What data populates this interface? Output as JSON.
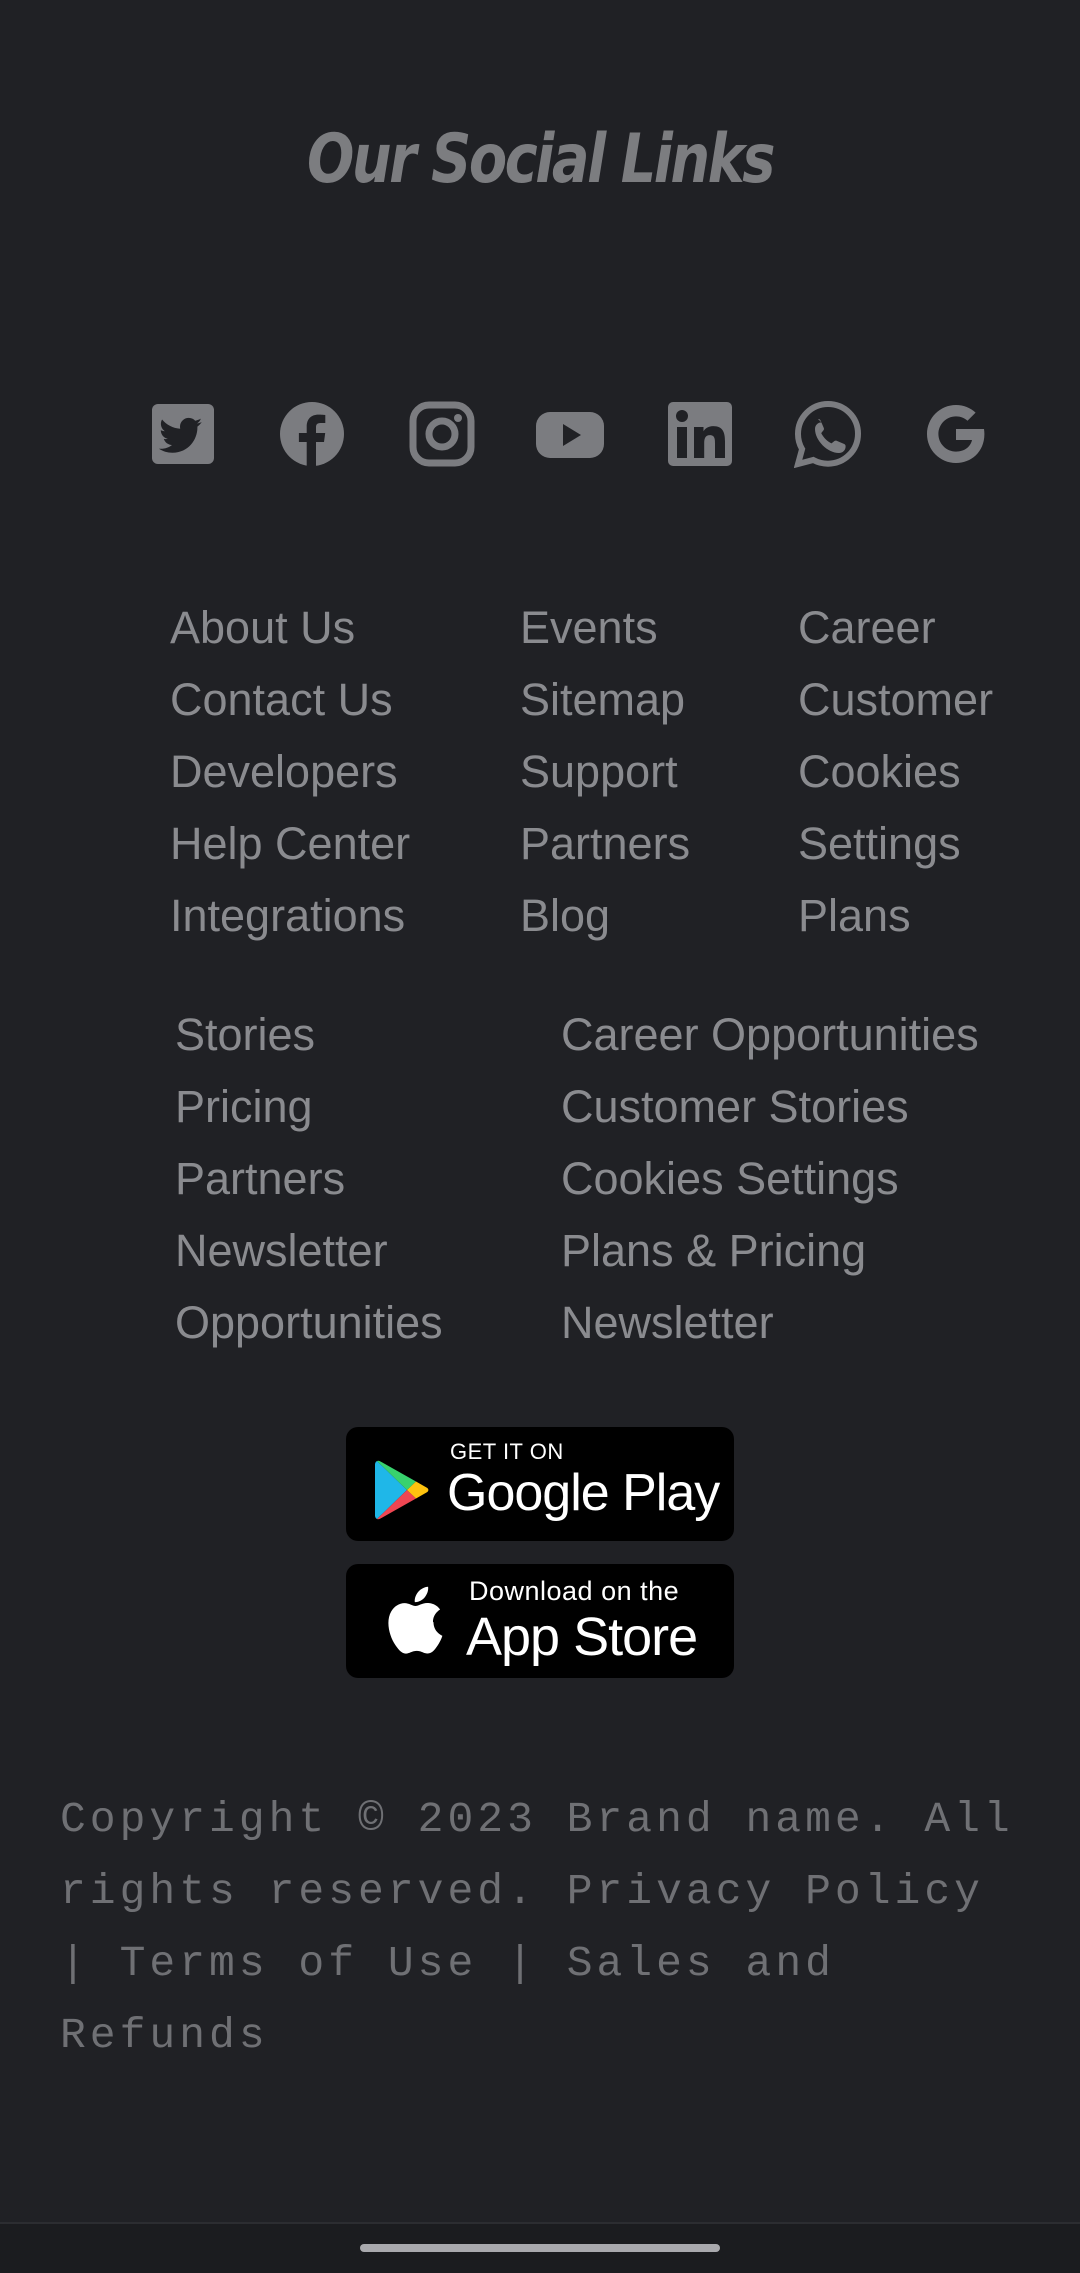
{
  "section_title": "Our Social Links",
  "social_icons": [
    "twitter-icon",
    "facebook-icon",
    "instagram-icon",
    "youtube-icon",
    "linkedin-icon",
    "whatsapp-icon",
    "google-icon"
  ],
  "links_grid_1": {
    "col1": [
      "About Us",
      "Contact Us",
      "Developers",
      "Help Center",
      "Integrations"
    ],
    "col2": [
      "Events",
      "Sitemap",
      "Support",
      "Partners",
      "Blog"
    ],
    "col3": [
      "Career",
      "Customer",
      "Cookies",
      "Settings",
      "Plans"
    ]
  },
  "links_grid_2": {
    "col1": [
      "Stories",
      "Pricing",
      "Partners",
      "Newsletter",
      "Opportunities"
    ],
    "col2": [
      "Career Opportunities",
      "Customer Stories",
      "Cookies Settings",
      "Plans & Pricing",
      "Newsletter"
    ]
  },
  "google_play": {
    "small": "GET IT ON",
    "big": "Google Play"
  },
  "app_store": {
    "small": "Download on the",
    "big": "App Store"
  },
  "copyright": {
    "text": "Copyright © 2023 Brand name. All rights reserved.",
    "privacy": "Privacy Policy",
    "sep1": " | ",
    "terms": "Terms of Use",
    "sep2": " | ",
    "sales": "Sales and Refunds"
  },
  "colors": {
    "background": "#202125",
    "text": "#8a8b8f",
    "icon": "#7b7c80",
    "store_badge": "#000000"
  }
}
